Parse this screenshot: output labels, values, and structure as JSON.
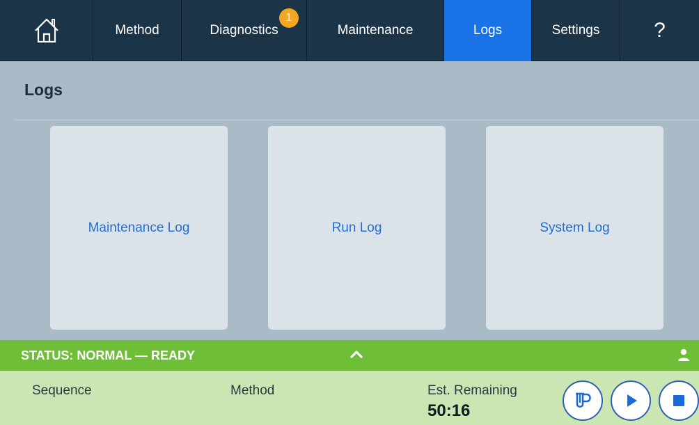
{
  "nav": {
    "home_icon": "home-icon",
    "items": [
      {
        "label": "Method"
      },
      {
        "label": "Diagnostics",
        "badge": "1"
      },
      {
        "label": "Maintenance"
      },
      {
        "label": "Logs",
        "active": true
      },
      {
        "label": "Settings"
      }
    ],
    "help_label": "?"
  },
  "page": {
    "title": "Logs",
    "tiles": [
      {
        "label": "Maintenance Log"
      },
      {
        "label": "Run Log"
      },
      {
        "label": "System Log"
      }
    ]
  },
  "status": {
    "text": "STATUS: NORMAL — READY",
    "color": "#6fbe37",
    "toggle_icon": "chevron-up-icon",
    "user_icon": "user-icon"
  },
  "panel": {
    "sequence_label": "Sequence",
    "method_label": "Method",
    "est_label": "Est. Remaining",
    "est_value": "50:16",
    "buttons": [
      "vial-icon",
      "play-icon",
      "stop-icon"
    ]
  },
  "colors": {
    "nav_bg": "#1c3447",
    "active_tab": "#1a73e6",
    "badge": "#f5a623",
    "tile_text": "#1f6fd1",
    "button_accent": "#1a6bd9"
  }
}
